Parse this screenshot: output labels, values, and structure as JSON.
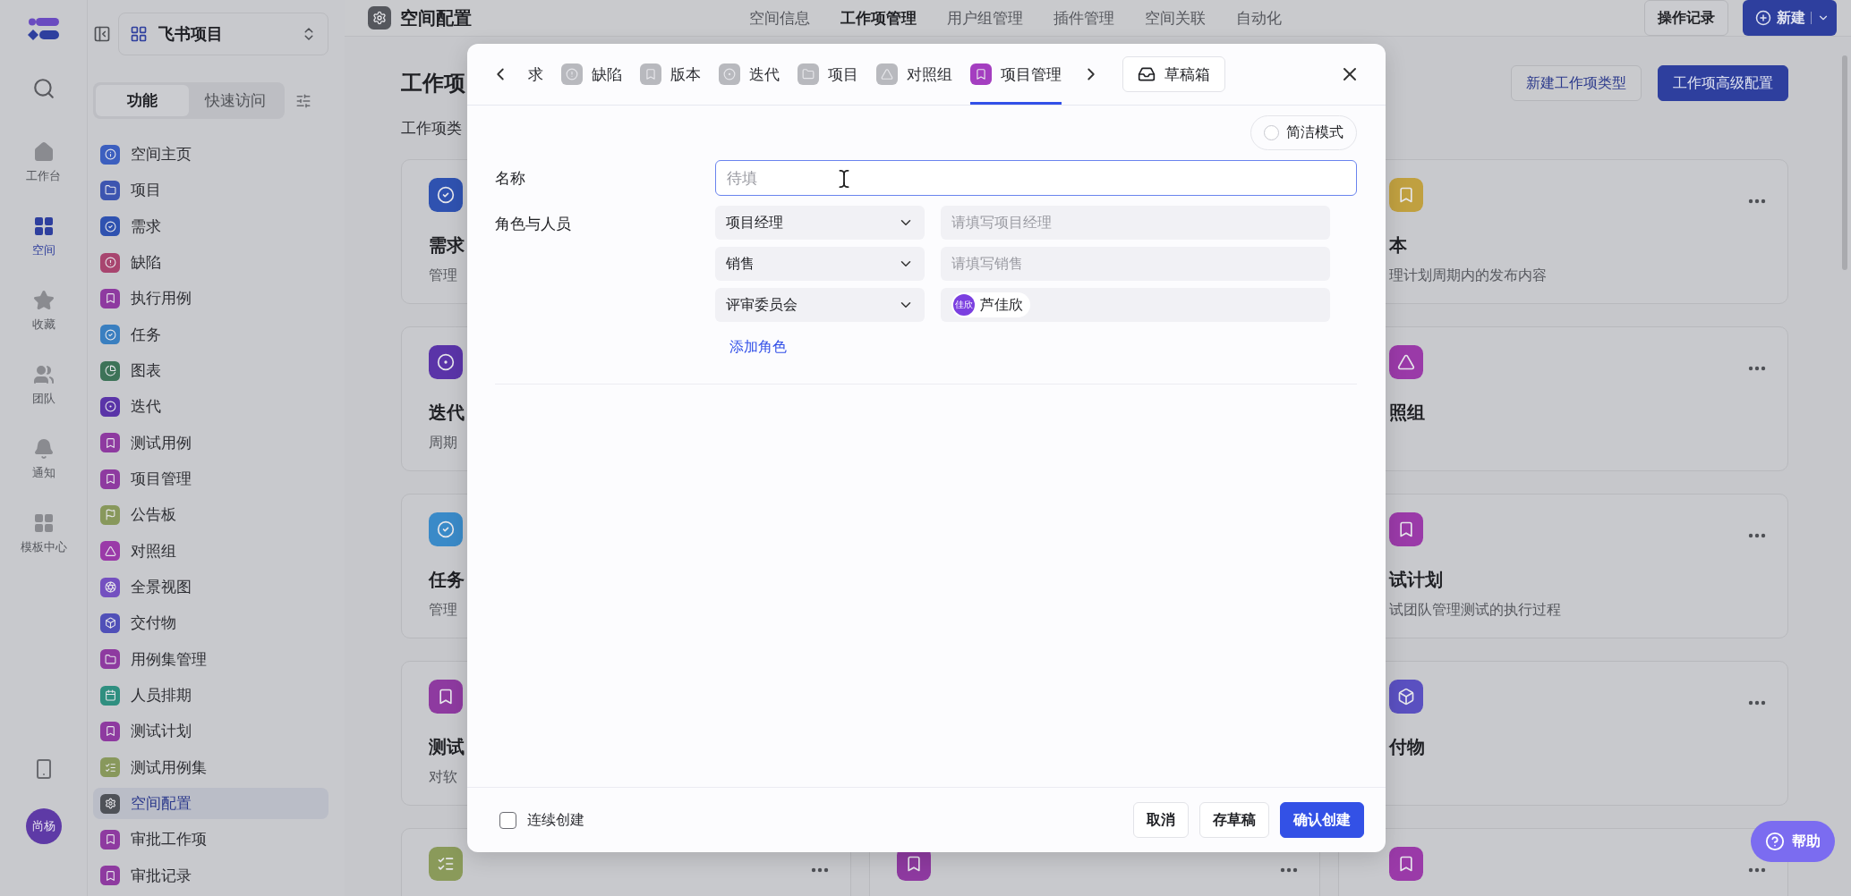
{
  "rail": {
    "items": [
      {
        "label": "工作台",
        "selected": false
      },
      {
        "label": "空间",
        "selected": true
      },
      {
        "label": "收藏",
        "selected": false
      },
      {
        "label": "团队",
        "selected": false
      },
      {
        "label": "通知",
        "selected": false
      },
      {
        "label": "模板中心",
        "selected": false
      }
    ],
    "avatar": "尚杨"
  },
  "sidebar": {
    "project": "飞书项目",
    "tabs": [
      {
        "label": "功能",
        "selected": true
      },
      {
        "label": "快速访问",
        "selected": false
      }
    ],
    "items": [
      {
        "label": "空间主页",
        "color": "#3c5fbf",
        "selected": false
      },
      {
        "label": "项目",
        "color": "#3d55b0",
        "selected": false
      },
      {
        "label": "需求",
        "color": "#2f52b0",
        "selected": false
      },
      {
        "label": "缺陷",
        "color": "#a8456f",
        "selected": false
      },
      {
        "label": "执行用例",
        "color": "#8e3aa0",
        "selected": false
      },
      {
        "label": "任务",
        "color": "#3a7fc0",
        "selected": false
      },
      {
        "label": "图表",
        "color": "#3d7358",
        "selected": false
      },
      {
        "label": "迭代",
        "color": "#5a34a8",
        "selected": false
      },
      {
        "label": "测试用例",
        "color": "#8e3aa0",
        "selected": false
      },
      {
        "label": "项目管理",
        "color": "#8e3aa0",
        "selected": false
      },
      {
        "label": "公告板",
        "color": "#88985c",
        "selected": false
      },
      {
        "label": "对照组",
        "color": "#9a3aa8",
        "selected": false
      },
      {
        "label": "全景视图",
        "color": "#7450c0",
        "selected": false
      },
      {
        "label": "交付物",
        "color": "#5050b8",
        "selected": false
      },
      {
        "label": "用例集管理",
        "color": "#8e3aa0",
        "selected": false
      },
      {
        "label": "人员排期",
        "color": "#2f8f80",
        "selected": false
      },
      {
        "label": "测试计划",
        "color": "#8e3aa0",
        "selected": false
      },
      {
        "label": "测试用例集",
        "color": "#88985c",
        "selected": false
      },
      {
        "label": "空间配置",
        "color": "#4f5258",
        "selected": true
      },
      {
        "label": "审批工作项",
        "color": "#8e3aa0",
        "selected": false
      },
      {
        "label": "审批记录",
        "color": "#8e3aa0",
        "selected": false
      }
    ]
  },
  "topbar": {
    "title": "空间配置",
    "nav": [
      {
        "label": "空间信息",
        "selected": false
      },
      {
        "label": "工作项管理",
        "selected": true
      },
      {
        "label": "用户组管理",
        "selected": false
      },
      {
        "label": "插件管理",
        "selected": false
      },
      {
        "label": "空间关联",
        "selected": false
      },
      {
        "label": "自动化",
        "selected": false
      }
    ],
    "history_button": "操作记录",
    "new_button": "新建"
  },
  "main": {
    "title": "工作项",
    "subtitle": "工作项类",
    "buttons": [
      {
        "label": "新建工作项类型",
        "kind": "outline"
      },
      {
        "label": "工作项高级配置",
        "kind": "primary"
      }
    ],
    "columns": [
      {
        "cards": [
          {
            "title": "需求",
            "description": "管理",
            "color": "#2f52b0"
          },
          {
            "title": "迭代",
            "description": "周期",
            "color": "#5a34a8"
          },
          {
            "title": "任务",
            "description": "管理",
            "color": "#3a8ac8"
          },
          {
            "title": "测试",
            "description": "对软",
            "color": "#8e3aa0"
          },
          {
            "color": "#8a9a5a",
            "more_menu": true
          }
        ]
      },
      {
        "cards": [
          {
            "color": "#8e3aa0",
            "more_menu": true
          }
        ]
      },
      {
        "cards": [
          {
            "title": "本",
            "description": "理计划周期内的发布内容",
            "color": "#c0a040",
            "more_menu": true
          },
          {
            "title": "照组",
            "color": "#9a3aa8",
            "more_menu": true
          },
          {
            "title": "试计划",
            "description": "试团队管理测试的执行过程",
            "color": "#9a3aa8",
            "more_menu": true
          },
          {
            "title": "付物",
            "color": "#5a50c0",
            "more_menu": true
          },
          {
            "color": "#9a3aa8",
            "more_menu": true
          }
        ]
      }
    ]
  },
  "modal": {
    "tabs": [
      {
        "label": "求",
        "selected": false
      },
      {
        "label": "缺陷",
        "selected": false
      },
      {
        "label": "版本",
        "selected": false
      },
      {
        "label": "迭代",
        "selected": false
      },
      {
        "label": "项目",
        "selected": false
      },
      {
        "label": "对照组",
        "selected": false
      },
      {
        "label": "项目管理",
        "selected": true
      }
    ],
    "drafts_button": "草稿箱",
    "simple_mode": {
      "label": "简洁模式",
      "on": false
    },
    "name": {
      "label": "名称",
      "placeholder": "待填"
    },
    "roles": {
      "label": "角色与人员",
      "rows": [
        {
          "role": "项目经理",
          "kind": "empty",
          "placeholder": "请填写项目经理"
        },
        {
          "role": "销售",
          "kind": "empty",
          "placeholder": "请填写销售"
        },
        {
          "role": "评审委员会",
          "kind": "person",
          "avatar": "佳欣",
          "name": "芦佳欣"
        }
      ],
      "add_link": "添加角色"
    },
    "continuous": {
      "label": "连续创建",
      "checked": false
    },
    "buttons": [
      {
        "label": "取消",
        "kind": "secondary"
      },
      {
        "label": "存草稿",
        "kind": "secondary"
      },
      {
        "label": "确认创建",
        "kind": "primary"
      }
    ]
  },
  "help_button": "帮助"
}
